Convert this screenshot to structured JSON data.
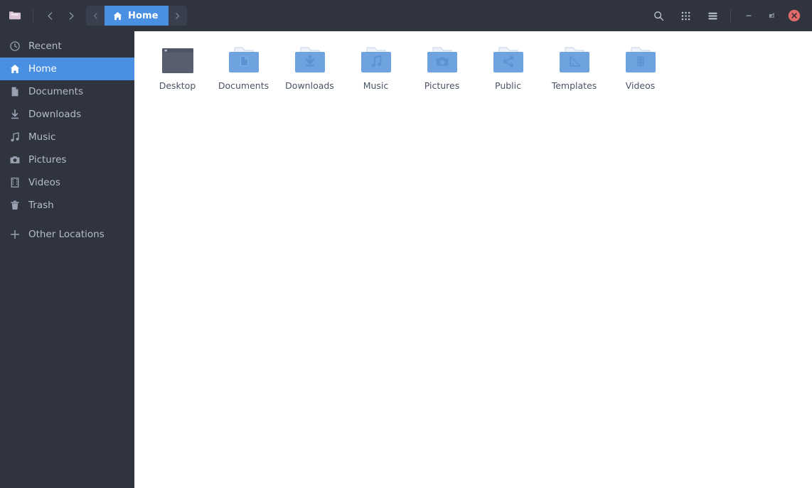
{
  "window": {
    "app_icon": "folder-app-icon",
    "background": "#2f343f",
    "content_background": "#ffffff",
    "accent": "#4a90e2",
    "close_color": "#e06a6a"
  },
  "titlebar": {
    "nav": {
      "back_icon": "chevron-left-icon",
      "forward_icon": "chevron-right-icon"
    },
    "breadcrumb": {
      "prev_icon": "chevron-left-icon",
      "next_icon": "chevron-right-icon",
      "current": {
        "label": "Home",
        "icon": "home-icon"
      }
    },
    "actions": [
      {
        "name": "search-button",
        "icon": "search-icon"
      },
      {
        "name": "view-grid-button",
        "icon": "grid-icon"
      },
      {
        "name": "menu-button",
        "icon": "hamburger-icon"
      }
    ],
    "window_controls": [
      {
        "name": "minimize-button",
        "icon": "minimize-icon"
      },
      {
        "name": "maximize-button",
        "icon": "maximize-icon"
      },
      {
        "name": "close-button",
        "icon": "close-icon"
      }
    ]
  },
  "sidebar": {
    "items": [
      {
        "label": "Recent",
        "icon": "clock-icon",
        "selected": false
      },
      {
        "label": "Home",
        "icon": "home-icon",
        "selected": true
      },
      {
        "label": "Documents",
        "icon": "document-icon",
        "selected": false
      },
      {
        "label": "Downloads",
        "icon": "download-icon",
        "selected": false
      },
      {
        "label": "Music",
        "icon": "music-icon",
        "selected": false
      },
      {
        "label": "Pictures",
        "icon": "camera-icon",
        "selected": false
      },
      {
        "label": "Videos",
        "icon": "film-icon",
        "selected": false
      },
      {
        "label": "Trash",
        "icon": "trash-icon",
        "selected": false
      }
    ],
    "other_locations": {
      "label": "Other Locations",
      "icon": "plus-icon"
    }
  },
  "main": {
    "files": [
      {
        "label": "Desktop",
        "icon": "desktop-window-icon"
      },
      {
        "label": "Documents",
        "icon": "folder-documents-icon"
      },
      {
        "label": "Downloads",
        "icon": "folder-downloads-icon"
      },
      {
        "label": "Music",
        "icon": "folder-music-icon"
      },
      {
        "label": "Pictures",
        "icon": "folder-pictures-icon"
      },
      {
        "label": "Public",
        "icon": "folder-public-icon"
      },
      {
        "label": "Templates",
        "icon": "folder-templates-icon"
      },
      {
        "label": "Videos",
        "icon": "folder-videos-icon"
      }
    ]
  }
}
